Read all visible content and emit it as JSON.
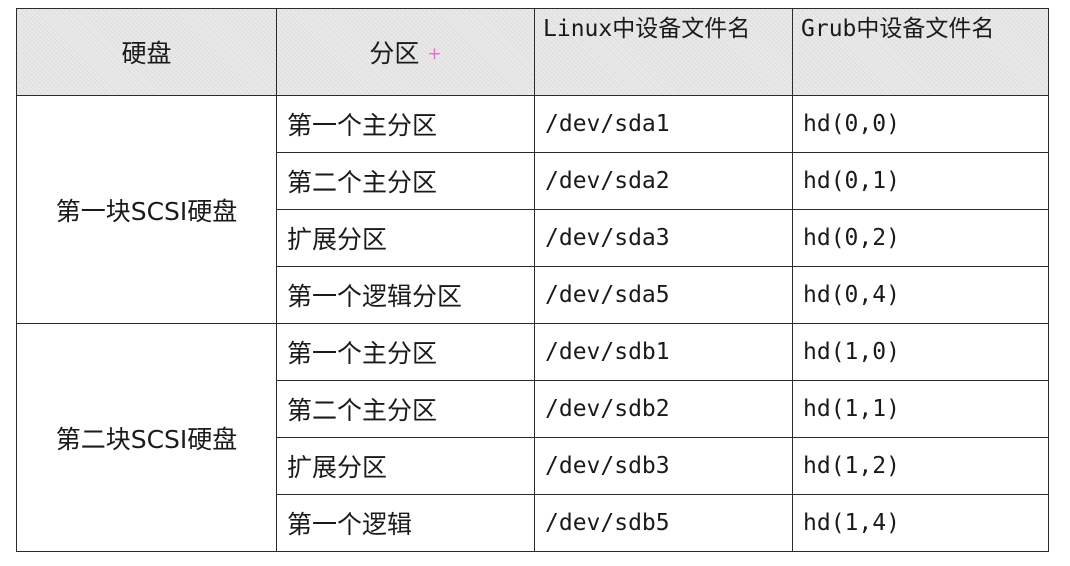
{
  "table": {
    "headers": {
      "disk": "硬盘",
      "partition": "分区",
      "partition_marker": "+",
      "linux_device": "Linux中设备文件名",
      "grub_device": "Grub中设备文件名"
    },
    "groups": [
      {
        "disk": "第一块SCSI硬盘",
        "rows": [
          {
            "partition": "第一个主分区",
            "linux": "/dev/sda1",
            "grub": "hd(0,0)"
          },
          {
            "partition": "第二个主分区",
            "linux": "/dev/sda2",
            "grub": "hd(0,1)"
          },
          {
            "partition": "扩展分区",
            "linux": "/dev/sda3",
            "grub": "hd(0,2)"
          },
          {
            "partition": "第一个逻辑分区",
            "linux": "/dev/sda5",
            "grub": "hd(0,4)"
          }
        ]
      },
      {
        "disk": "第二块SCSI硬盘",
        "rows": [
          {
            "partition": "第一个主分区",
            "linux": "/dev/sdb1",
            "grub": "hd(1,0)"
          },
          {
            "partition": "第二个主分区",
            "linux": "/dev/sdb2",
            "grub": "hd(1,1)"
          },
          {
            "partition": "扩展分区",
            "linux": "/dev/sdb3",
            "grub": "hd(1,2)"
          },
          {
            "partition": "第一个逻辑",
            "linux": "/dev/sdb5",
            "grub": "hd(1,4)"
          }
        ]
      }
    ]
  }
}
